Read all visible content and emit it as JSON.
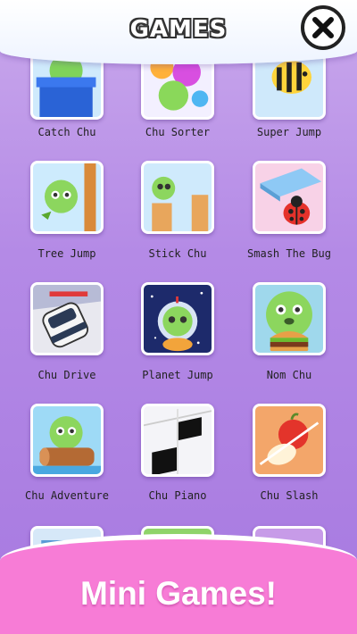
{
  "header": {
    "title": "GAMES",
    "close_icon": "close-x-icon"
  },
  "games": [
    {
      "label": "Catch Chu",
      "icon": "chu-pipe-icon"
    },
    {
      "label": "Chu Sorter",
      "icon": "color-balls-icon"
    },
    {
      "label": "Super Jump",
      "icon": "bee-icon"
    },
    {
      "label": "Tree Jump",
      "icon": "chu-tree-icon"
    },
    {
      "label": "Stick Chu",
      "icon": "chu-pillar-icon"
    },
    {
      "label": "Smash The Bug",
      "icon": "ladybug-book-icon"
    },
    {
      "label": "Chu Drive",
      "icon": "car-icon"
    },
    {
      "label": "Planet Jump",
      "icon": "astronaut-chu-icon"
    },
    {
      "label": "Nom Chu",
      "icon": "burger-chu-icon"
    },
    {
      "label": "Chu Adventure",
      "icon": "chu-log-icon"
    },
    {
      "label": "Chu Piano",
      "icon": "piano-tiles-icon"
    },
    {
      "label": "Chu Slash",
      "icon": "sliced-fruit-icon"
    }
  ],
  "footer": {
    "title": "Mini Games!"
  }
}
